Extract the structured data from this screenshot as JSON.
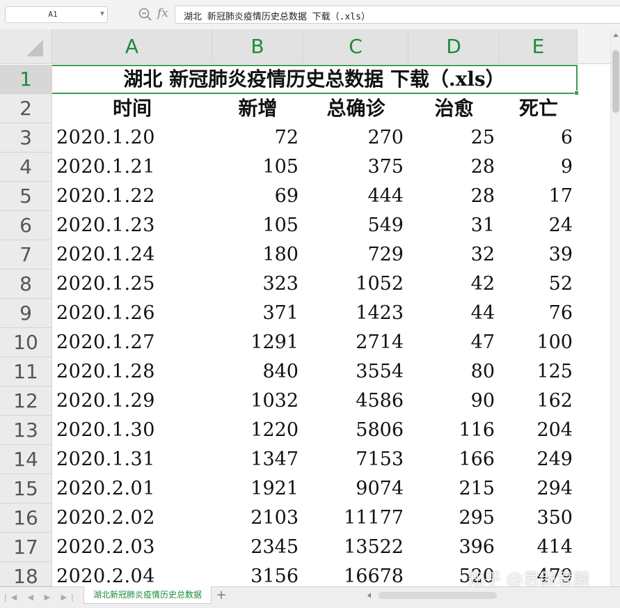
{
  "formula_bar": {
    "name_box": "A1",
    "fx_label": "fx",
    "formula": "湖北 新冠肺炎疫情历史总数据 下载（.xls）"
  },
  "columns": [
    "A",
    "B",
    "C",
    "D",
    "E"
  ],
  "rows": [
    "1",
    "2",
    "3",
    "4",
    "5",
    "6",
    "7",
    "8",
    "9",
    "10",
    "11",
    "12",
    "13",
    "14",
    "15",
    "16",
    "17",
    "18"
  ],
  "title": "湖北 新冠肺炎疫情历史总数据 下载（.xls）",
  "headers": [
    "时间",
    "新增",
    "总确诊",
    "治愈",
    "死亡"
  ],
  "data": [
    [
      "2020.1.20",
      "72",
      "270",
      "25",
      "6"
    ],
    [
      "2020.1.21",
      "105",
      "375",
      "28",
      "9"
    ],
    [
      "2020.1.22",
      "69",
      "444",
      "28",
      "17"
    ],
    [
      "2020.1.23",
      "105",
      "549",
      "31",
      "24"
    ],
    [
      "2020.1.24",
      "180",
      "729",
      "32",
      "39"
    ],
    [
      "2020.1.25",
      "323",
      "1052",
      "42",
      "52"
    ],
    [
      "2020.1.26",
      "371",
      "1423",
      "44",
      "76"
    ],
    [
      "2020.1.27",
      "1291",
      "2714",
      "47",
      "100"
    ],
    [
      "2020.1.28",
      "840",
      "3554",
      "80",
      "125"
    ],
    [
      "2020.1.29",
      "1032",
      "4586",
      "90",
      "162"
    ],
    [
      "2020.1.30",
      "1220",
      "5806",
      "116",
      "204"
    ],
    [
      "2020.1.31",
      "1347",
      "7153",
      "166",
      "249"
    ],
    [
      "2020.2.01",
      "1921",
      "9074",
      "215",
      "294"
    ],
    [
      "2020.2.02",
      "2103",
      "11177",
      "295",
      "350"
    ],
    [
      "2020.2.03",
      "2345",
      "13522",
      "396",
      "414"
    ],
    [
      "2020.2.04",
      "3156",
      "16678",
      "520",
      "479"
    ]
  ],
  "sheet_tab": "湖北新冠肺炎疫情历史总数据",
  "add_sheet": "+",
  "watermark": "知乎 @君颜君颜",
  "colors": {
    "accent_green": "#1b8b3a",
    "selection_border": "#3d9a4f"
  }
}
